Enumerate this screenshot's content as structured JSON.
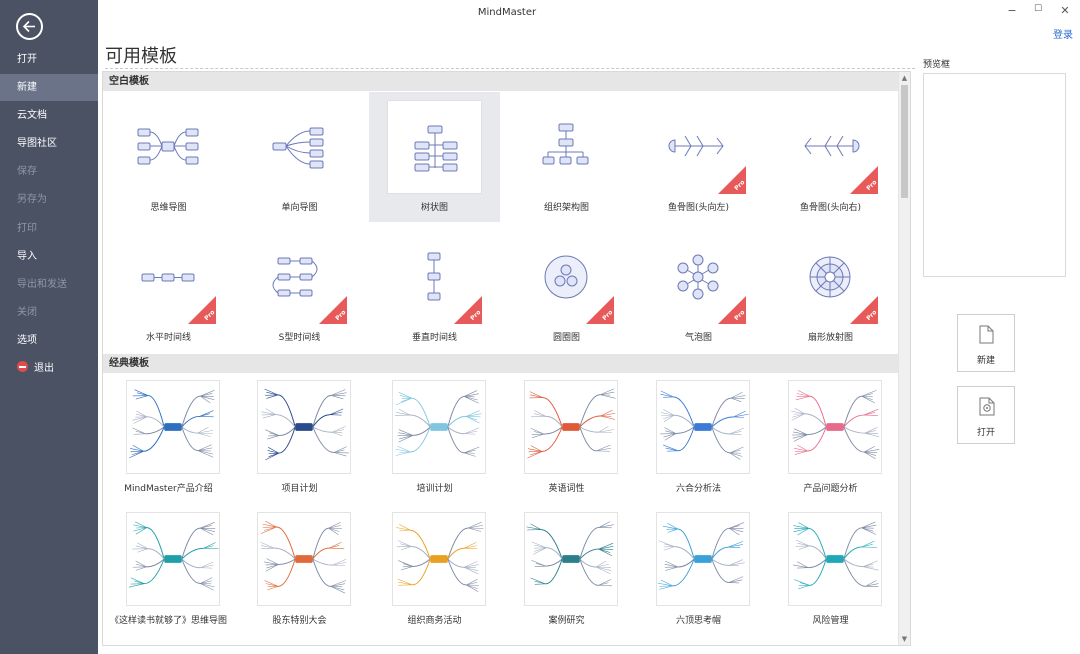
{
  "window": {
    "title": "MindMaster",
    "login": "登录",
    "min_glyph": "−",
    "max_glyph": "☐",
    "close_glyph": "✕"
  },
  "sidebar": {
    "back_icon": "back-arrow-icon",
    "items": [
      {
        "label": "打开",
        "state": "normal"
      },
      {
        "label": "新建",
        "state": "active"
      },
      {
        "label": "云文档",
        "state": "normal"
      },
      {
        "label": "导图社区",
        "state": "normal"
      },
      {
        "label": "保存",
        "state": "disabled"
      },
      {
        "label": "另存为",
        "state": "disabled"
      },
      {
        "label": "打印",
        "state": "disabled"
      },
      {
        "label": "导入",
        "state": "normal"
      },
      {
        "label": "导出和发送",
        "state": "disabled"
      },
      {
        "label": "关闭",
        "state": "disabled"
      },
      {
        "label": "选项",
        "state": "normal"
      },
      {
        "label": "退出",
        "state": "exit"
      }
    ]
  },
  "main": {
    "title": "可用模板",
    "blank_section": {
      "header": "空白模板",
      "templates": [
        {
          "label": "思维导图",
          "icon": "mind-map-icon",
          "pro": false,
          "selected": false
        },
        {
          "label": "单向导图",
          "icon": "right-map-icon",
          "pro": false,
          "selected": false
        },
        {
          "label": "树状图",
          "icon": "tree-map-icon",
          "pro": false,
          "selected": true
        },
        {
          "label": "组织架构图",
          "icon": "org-chart-icon",
          "pro": false,
          "selected": false
        },
        {
          "label": "鱼骨图(头向左)",
          "icon": "fishbone-left-icon",
          "pro": true,
          "selected": false
        },
        {
          "label": "鱼骨图(头向右)",
          "icon": "fishbone-right-icon",
          "pro": true,
          "selected": false
        },
        {
          "label": "水平时间线",
          "icon": "horizontal-timeline-icon",
          "pro": true,
          "selected": false
        },
        {
          "label": "S型时间线",
          "icon": "s-timeline-icon",
          "pro": true,
          "selected": false
        },
        {
          "label": "垂直时间线",
          "icon": "vertical-timeline-icon",
          "pro": true,
          "selected": false
        },
        {
          "label": "圆圈图",
          "icon": "circle-map-icon",
          "pro": true,
          "selected": false
        },
        {
          "label": "气泡图",
          "icon": "bubble-map-icon",
          "pro": true,
          "selected": false
        },
        {
          "label": "扇形放射图",
          "icon": "radial-map-icon",
          "pro": true,
          "selected": false
        }
      ],
      "pro_text": "Pro"
    },
    "classic_section": {
      "header": "经典模板",
      "templates": [
        {
          "label": "MindMaster产品介绍",
          "accent": "#2f6fbf"
        },
        {
          "label": "项目计划",
          "accent": "#2b4a8c"
        },
        {
          "label": "培训计划",
          "accent": "#7fc6e0"
        },
        {
          "label": "英语词性",
          "accent": "#e05a3a"
        },
        {
          "label": "六合分析法",
          "accent": "#3a7bd5"
        },
        {
          "label": "产品问题分析",
          "accent": "#e76a8a"
        },
        {
          "label": "《这样读书就够了》思维导图",
          "accent": "#1fa0a8"
        },
        {
          "label": "股东特别大会",
          "accent": "#e06a3a"
        },
        {
          "label": "组织商务活动",
          "accent": "#e9a020"
        },
        {
          "label": "案例研究",
          "accent": "#2a7f8a"
        },
        {
          "label": "六顶思考帽",
          "accent": "#39a0d8"
        },
        {
          "label": "风险管理",
          "accent": "#1fa8b8"
        }
      ]
    }
  },
  "preview": {
    "label": "预览框",
    "new_button": "新建",
    "new_icon": "document-icon",
    "open_button": "打开",
    "open_icon": "open-file-icon"
  }
}
